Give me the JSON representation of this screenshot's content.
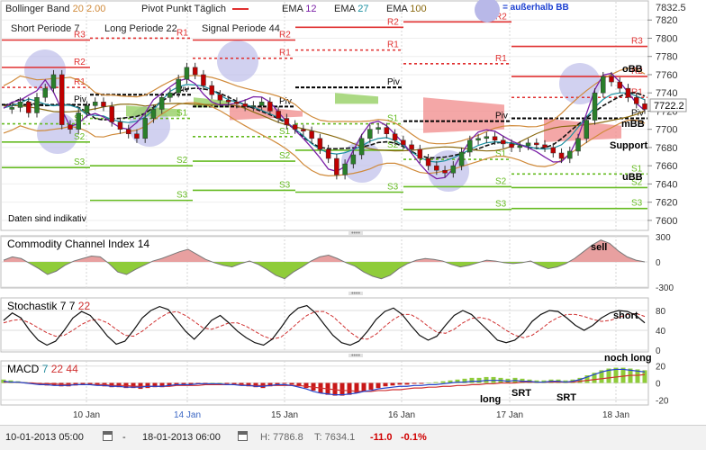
{
  "legend": {
    "bollinger": "Bollinger Band",
    "bollinger_p1": "20",
    "bollinger_p2": "2.00",
    "pivot": "Pivot Punkt",
    "pivot_period": "Täglich",
    "ema1_label": "EMA",
    "ema1_period": "12",
    "ema2_label": "EMA",
    "ema2_period": "27",
    "ema3_label": "EMA",
    "ema3_period": "100",
    "outside_bb": "= außerhalb BB",
    "short_label": "Short Periode",
    "short_period": "7",
    "long_label": "Long Periode",
    "long_period": "22",
    "signal_label": "Signal Periode",
    "signal_period": "44",
    "disclaimer": "Daten sind indikativ"
  },
  "colors": {
    "price_up": "#2a7f2a",
    "price_down": "#c00000",
    "bb": "#d08a3a",
    "ema12": "#7a1fa6",
    "ema27": "#1a8fa0",
    "ema100": "#8a6a10",
    "pivot": "#000000",
    "resistance": "#e03030",
    "support": "#66bb22",
    "cloud": "#f08a8a",
    "bubble": "#b8b8e8"
  },
  "annotations": {
    "obb": "oBB",
    "mbb": "mBB",
    "ubb": "uBB",
    "support": "Support",
    "cci_signal": "sell",
    "stoch_signal": "short",
    "macd_signal": "noch long",
    "macd_long": "long",
    "macd_srt1": "SRT",
    "macd_srt2": "SRT"
  },
  "panels": {
    "cci": {
      "title": "Commodity Channel Index",
      "period": "14"
    },
    "stoch": {
      "title": "Stochastik",
      "k": "7",
      "d": "7",
      "s": "22"
    },
    "macd": {
      "title": "MACD",
      "fast": "7",
      "slow": "22",
      "signal": "44"
    }
  },
  "footer": {
    "from": "10-01-2013 05:00",
    "to": "18-01-2013 06:00",
    "high": "H: 7786.8",
    "low": "T: 7634.1",
    "change": "-11.0",
    "change_pct": "-0.1%"
  },
  "chart_data": [
    {
      "type": "line",
      "title": "",
      "x": [
        "10 Jan",
        "14 Jan",
        "15 Jan",
        "16 Jan",
        "17 Jan",
        "18 Jan"
      ],
      "ylim": [
        7590,
        7840
      ],
      "y_ticks": [
        7600,
        7620,
        7640,
        7660,
        7680,
        7700,
        7720,
        7740,
        7760,
        7780,
        7800,
        7820
      ],
      "y_ticks_extra": [
        "7832.5"
      ],
      "current_price": "7722.2",
      "price_path": [
        7722,
        7724,
        7730,
        7718,
        7735,
        7745,
        7760,
        7705,
        7700,
        7718,
        7726,
        7730,
        7725,
        7708,
        7700,
        7695,
        7690,
        7712,
        7722,
        7735,
        7740,
        7755,
        7768,
        7760,
        7748,
        7738,
        7732,
        7730,
        7728,
        7725,
        7726,
        7730,
        7720,
        7712,
        7705,
        7700,
        7698,
        7690,
        7678,
        7668,
        7650,
        7662,
        7672,
        7690,
        7700,
        7702,
        7695,
        7688,
        7683,
        7678,
        7668,
        7660,
        7655,
        7652,
        7660,
        7675,
        7688,
        7690,
        7692,
        7688,
        7684,
        7680,
        7682,
        7685,
        7683,
        7680,
        7674,
        7668,
        7676,
        7690,
        7710,
        7740,
        7758,
        7752,
        7745,
        7735,
        7728,
        7722
      ],
      "pivot_levels": [
        {
          "day": "10 Jan",
          "R3": 7798,
          "R2": 7768,
          "R1": 7746,
          "Piv": 7727,
          "S1": 7706,
          "S2": 7686,
          "S3": 7658
        },
        {
          "day": "14 Jan",
          "R1": 7800,
          "Piv": 7738,
          "S1": 7712,
          "S2": 7660,
          "S3": 7622
        },
        {
          "day": "15 Jan",
          "R2": 7798,
          "R1": 7778,
          "Piv": 7725,
          "S1": 7692,
          "S2": 7665,
          "S3": 7633
        },
        {
          "day": "16 Jan",
          "R2": 7812,
          "R1": 7787,
          "Piv": 7746,
          "S1": 7706,
          "S2": 7677,
          "S3": 7631
        },
        {
          "day": "17 Jan",
          "R2": 7818,
          "R1": 7772,
          "Piv": 7709,
          "S1": 7667,
          "S2": 7637,
          "S3": 7612
        },
        {
          "day": "18 Jan",
          "R3": 7791,
          "R2": 7758,
          "R1": 7735,
          "Piv": 7712,
          "S1": 7651,
          "S2": 7636,
          "S3": 7613
        }
      ]
    },
    {
      "type": "line",
      "title": "Commodity Channel Index 14",
      "ylim": [
        -300,
        300
      ],
      "y_ticks": [
        -300,
        0,
        300
      ],
      "values": [
        20,
        60,
        40,
        -20,
        -80,
        -150,
        -110,
        -40,
        10,
        40,
        70,
        60,
        -20,
        -120,
        -150,
        -90,
        -40,
        10,
        40,
        80,
        120,
        150,
        90,
        30,
        -10,
        -40,
        -60,
        -20,
        10,
        -30,
        -90,
        -160,
        -200,
        -120,
        -60,
        10,
        60,
        80,
        40,
        -10,
        -50,
        -120,
        -170,
        -200,
        -160,
        -80,
        -20,
        20,
        40,
        30,
        10,
        -30,
        -60,
        -40,
        -10,
        20,
        10,
        -10,
        -20,
        -10,
        10,
        -40,
        -80,
        -60,
        -20,
        40,
        120,
        200,
        260,
        220,
        130,
        60,
        20,
        0
      ]
    },
    {
      "type": "line",
      "title": "Stochastik 7 7 22",
      "ylim": [
        0,
        100
      ],
      "y_ticks": [
        0,
        40,
        80
      ],
      "values_k": [
        60,
        75,
        65,
        40,
        20,
        10,
        18,
        40,
        65,
        78,
        70,
        50,
        28,
        12,
        18,
        40,
        65,
        80,
        88,
        82,
        60,
        38,
        22,
        40,
        60,
        70,
        55,
        38,
        25,
        15,
        10,
        22,
        45,
        70,
        85,
        90,
        75,
        52,
        30,
        15,
        10,
        18,
        38,
        62,
        78,
        85,
        72,
        50,
        30,
        20,
        28,
        50,
        70,
        80,
        72,
        55,
        38,
        20,
        15,
        20,
        35,
        58,
        72,
        80,
        78,
        65,
        50,
        40,
        50,
        65,
        75,
        80,
        78,
        70,
        55
      ],
      "values_d": [
        55,
        60,
        62,
        55,
        45,
        35,
        28,
        30,
        40,
        52,
        60,
        62,
        55,
        42,
        30,
        28,
        38,
        52,
        65,
        75,
        78,
        70,
        58,
        45,
        42,
        48,
        55,
        55,
        48,
        38,
        28,
        22,
        26,
        40,
        56,
        70,
        78,
        78,
        68,
        52,
        36,
        24,
        22,
        32,
        48,
        62,
        72,
        72,
        62,
        48,
        36,
        34,
        42,
        55,
        64,
        66,
        62,
        52,
        40,
        30,
        25,
        30,
        42,
        56,
        66,
        72,
        72,
        68,
        62,
        58,
        60,
        66,
        72,
        74,
        68
      ]
    },
    {
      "type": "bar",
      "title": "MACD 7 22 44",
      "ylim": [
        -25,
        25
      ],
      "y_ticks": [
        -20,
        0,
        20
      ],
      "histogram": [
        4,
        3,
        2,
        1,
        -1,
        -2,
        -3,
        -3,
        -4,
        -4,
        -3,
        -2,
        -2,
        -3,
        -4,
        -5,
        -5,
        -6,
        -6,
        -7,
        -6,
        -5,
        -5,
        -4,
        -3,
        -3,
        -2,
        -1,
        -1,
        0,
        0,
        -1,
        -2,
        -3,
        -4,
        -5,
        -6,
        -4,
        -2,
        -1,
        -2,
        -4,
        -6,
        -9,
        -12,
        -14,
        -15,
        -15,
        -14,
        -12,
        -10,
        -8,
        -6,
        -4,
        -3,
        -2,
        -2,
        -1,
        -1,
        0,
        1,
        2,
        3,
        4,
        5,
        6,
        6,
        7,
        7,
        6,
        5,
        6,
        5,
        4,
        3,
        3,
        4,
        4,
        3,
        4,
        6,
        9,
        12,
        15,
        17,
        18,
        18,
        17,
        16,
        15
      ],
      "macd_line": [
        2,
        1,
        1,
        0,
        -1,
        -2,
        -2,
        -3,
        -3,
        -3,
        -2,
        -2,
        -2,
        -3,
        -3,
        -4,
        -4,
        -5,
        -5,
        -5,
        -4,
        -4,
        -4,
        -3,
        -2,
        -2,
        -2,
        -1,
        -1,
        -1,
        -1,
        -2,
        -2,
        -3,
        -3,
        -4,
        -4,
        -3,
        -2,
        -2,
        -3,
        -5,
        -7,
        -10,
        -12,
        -13,
        -14,
        -14,
        -13,
        -12,
        -10,
        -9,
        -7,
        -6,
        -5,
        -4,
        -4,
        -3,
        -3,
        -2,
        -2,
        -1,
        0,
        1,
        1,
        2,
        2,
        3,
        3,
        3,
        2,
        3,
        2,
        2,
        1,
        1,
        2,
        2,
        1,
        2,
        4,
        7,
        10,
        13,
        15,
        16,
        16,
        15,
        14,
        13
      ],
      "signal_line": [
        1,
        1,
        1,
        0,
        0,
        -1,
        -1,
        -1,
        -2,
        -2,
        -2,
        -2,
        -2,
        -2,
        -2,
        -3,
        -3,
        -3,
        -4,
        -4,
        -4,
        -4,
        -4,
        -4,
        -3,
        -3,
        -3,
        -3,
        -2,
        -2,
        -2,
        -2,
        -2,
        -2,
        -3,
        -3,
        -3,
        -3,
        -3,
        -3,
        -3,
        -3,
        -4,
        -5,
        -6,
        -7,
        -8,
        -9,
        -9,
        -10,
        -10,
        -10,
        -9,
        -9,
        -8,
        -8,
        -7,
        -6,
        -6,
        -5,
        -5,
        -4,
        -4,
        -3,
        -3,
        -2,
        -2,
        -1,
        -1,
        0,
        0,
        0,
        1,
        1,
        1,
        1,
        1,
        1,
        1,
        1,
        2,
        3,
        4,
        5,
        6,
        7,
        8,
        9,
        9,
        10
      ]
    }
  ]
}
